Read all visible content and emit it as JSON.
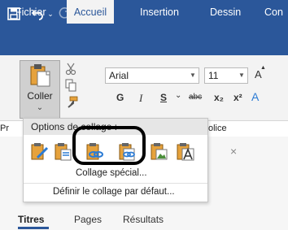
{
  "tabs": [
    "Fichier",
    "Accueil",
    "Insertion",
    "Dessin",
    "Con"
  ],
  "clipboard": {
    "paste_label": "Coller",
    "paste_caret": "⌄",
    "group_label_prefix": "Pr"
  },
  "font": {
    "name": "Arial",
    "size": "11",
    "grow": "A",
    "group_label_suffix": "olice"
  },
  "format": {
    "bold": "G",
    "italic": "I",
    "underline": "S",
    "caret": "⌄",
    "strike": "abc",
    "sub": "x₂",
    "sup": "x²",
    "effects": "A"
  },
  "paste_options": {
    "title": "Options de collage :",
    "items": [
      {
        "icon": "paste-keep-source-formatting-icon"
      },
      {
        "icon": "paste-merge-formatting-icon"
      },
      {
        "icon": "paste-link-keep-source-icon"
      },
      {
        "icon": "paste-link-merge-icon"
      },
      {
        "icon": "paste-picture-icon"
      },
      {
        "icon": "paste-text-only-icon"
      }
    ],
    "special": "Collage spécial...",
    "default": "Définir le collage par défaut..."
  },
  "nav": {
    "tabs": [
      "Titres",
      "Pages",
      "Résultats"
    ],
    "active": "Titres"
  },
  "colors": {
    "brand": "#2b579a",
    "ribbon": "#f3f3f3",
    "clip_orange": "#e6a23c",
    "link_blue": "#2b7bd4"
  }
}
